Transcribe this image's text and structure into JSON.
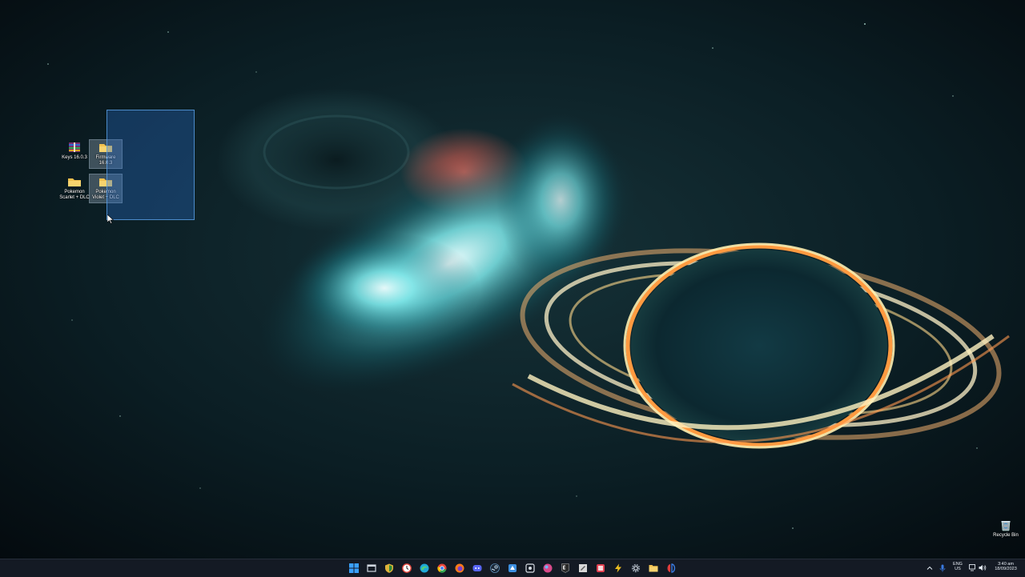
{
  "desktop": {
    "icons": [
      {
        "label": "Keys 16.0.3",
        "icon": "winrar-archive-icon"
      },
      {
        "label": "Firmware 16.0.3",
        "icon": "folder-icon"
      },
      {
        "label": "Pokemon Scarlet + DLC",
        "icon": "folder-icon"
      },
      {
        "label": "Pokemon Violet + DLC",
        "icon": "folder-icon"
      }
    ],
    "recycle_bin": {
      "label": "Recycle Bin",
      "icon": "recycle-bin-icon"
    }
  },
  "taskbar": {
    "apps": [
      {
        "name": "start-button",
        "icon": "windows-logo-icon",
        "color": "#3aa0ff"
      },
      {
        "name": "task-view",
        "icon": "task-view-icon",
        "color": "#cfd6df"
      },
      {
        "name": "app-shield",
        "icon": "shield-icon",
        "color": "#e0b43a"
      },
      {
        "name": "app-clock",
        "icon": "clock-icon",
        "color": "#e2463c"
      },
      {
        "name": "app-edge",
        "icon": "edge-icon",
        "color": "#1fa8d8"
      },
      {
        "name": "app-chrome",
        "icon": "chrome-icon",
        "color": "#e8453c"
      },
      {
        "name": "app-firefox",
        "icon": "firefox-icon",
        "color": "#ff7a1a"
      },
      {
        "name": "app-discord",
        "icon": "discord-icon",
        "color": "#5865f2"
      },
      {
        "name": "app-steam",
        "icon": "steam-icon",
        "color": "#1b2838"
      },
      {
        "name": "app-blue",
        "icon": "app-blue-icon",
        "color": "#3c8fe0"
      },
      {
        "name": "app-square",
        "icon": "app-square-icon",
        "color": "#8a8f98"
      },
      {
        "name": "app-ball",
        "icon": "app-ball-icon",
        "color": "#d94a8a"
      },
      {
        "name": "app-epic",
        "icon": "epic-games-icon",
        "color": "#2a2a2a"
      },
      {
        "name": "app-editor",
        "icon": "editor-icon",
        "color": "#d8d8d8"
      },
      {
        "name": "app-red",
        "icon": "app-red-icon",
        "color": "#e04050"
      },
      {
        "name": "app-yellow",
        "icon": "app-yellow-icon",
        "color": "#f0c020"
      },
      {
        "name": "settings",
        "icon": "gear-icon",
        "color": "#9aa4b0"
      },
      {
        "name": "file-explorer",
        "icon": "folder-icon",
        "color": "#f2c14e"
      },
      {
        "name": "app-emulator",
        "icon": "emulator-icon",
        "color": "#e03c3c"
      }
    ],
    "tray": {
      "language_line1": "ENG",
      "language_line2": "US",
      "time": "3:40 am",
      "date": "18/09/2023"
    }
  }
}
